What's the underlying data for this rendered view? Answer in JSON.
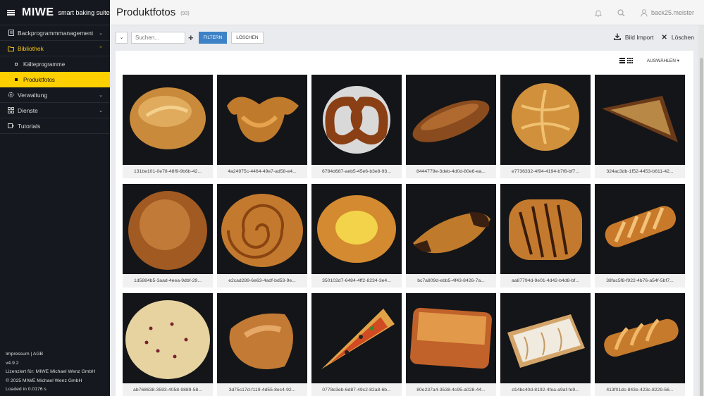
{
  "sidebar": {
    "brand": {
      "logo": "MIWE",
      "tagline": "smart baking suite"
    },
    "items": [
      {
        "label": "Backprogrammmanagement",
        "icon": "document-icon"
      },
      {
        "label": "Bibliothek",
        "icon": "folder-icon",
        "children": [
          {
            "label": "Kälteprogramme"
          },
          {
            "label": "Produktfotos"
          }
        ]
      },
      {
        "label": "Verwaltung",
        "icon": "gear-icon"
      },
      {
        "label": "Dienste",
        "icon": "grid-icon"
      },
      {
        "label": "Tutorials",
        "icon": "video-icon"
      }
    ],
    "footer": {
      "links": "Impressum | AGB",
      "version": "v4.9.2",
      "licensed": "Lizenziert für: MIWE Michael Wenz GmbH",
      "copyright": "© 2025 MIWE Michael Wenz GmbH",
      "loaded": "Loaded in 0.0176 s"
    }
  },
  "header": {
    "title": "Produktfotos",
    "count": "(93)",
    "user": "back25.meister"
  },
  "toolbar": {
    "toggle": "⌄",
    "search_placeholder": "Suchen...",
    "add": "+",
    "filter": "FILTERN",
    "clear": "LÖSCHEN",
    "bild_import": "Bild Import",
    "loeschen": "Löschen"
  },
  "view": {
    "select_label": "AUSWÄHLEN ▾"
  },
  "colors": {
    "accent": "#ffd000",
    "primary_button": "#3d82c6",
    "sidebar_bg": "#15181e"
  },
  "photos": [
    {
      "caption": "131be101-0e78-48f9-9b6b-42...",
      "kind": "bread-roll"
    },
    {
      "caption": "4a24975c-4464-49e7-ad58-e4...",
      "kind": "croissant"
    },
    {
      "caption": "6784d687-aeb5-45e6-b3e8-93...",
      "kind": "pretzel"
    },
    {
      "caption": "8444779e-3deb-4d0d-80e6-ea...",
      "kind": "baguette"
    },
    {
      "caption": "e7736332-4f94-4194-b7f8-bf7...",
      "kind": "kaiser-roll"
    },
    {
      "caption": "324ac3db-1f52-4453-b611-42...",
      "kind": "nut-triangle"
    },
    {
      "caption": "1d5884b5-3aad-4eea-9dbf-29...",
      "kind": "round-loaf"
    },
    {
      "caption": "e2cad289-6e63-4adf-bd53-9e...",
      "kind": "cinnamon-swirl"
    },
    {
      "caption": "350102d7-6484-4ff2-8234-3e4...",
      "kind": "custard-danish"
    },
    {
      "caption": "bc7a809d-ebb5-4f43-8426-7a...",
      "kind": "chocolate-croissant"
    },
    {
      "caption": "aa87794d-9e01-4d42-b4d8-bf...",
      "kind": "chocolate-plait"
    },
    {
      "caption": "38fac5f8-f922-4b76-a54f-5bf7...",
      "kind": "pastry-stick"
    },
    {
      "caption": "ab768638-3593-4058-9889-58...",
      "kind": "flatbread"
    },
    {
      "caption": "3d75c17d-f119-4d55-8ec4-92...",
      "kind": "ham-croissant"
    },
    {
      "caption": "0778e3eb-6d87-49c2-82a8-6b...",
      "kind": "pizza-slice"
    },
    {
      "caption": "80e237a4-3538-4c95-a028-44...",
      "kind": "lasagna-square"
    },
    {
      "caption": "d14bc40d-8192-4fea-a9af-fe9...",
      "kind": "iced-strudel"
    },
    {
      "caption": "413f01dc-843e-423c-8229-56...",
      "kind": "twist-stick"
    }
  ]
}
